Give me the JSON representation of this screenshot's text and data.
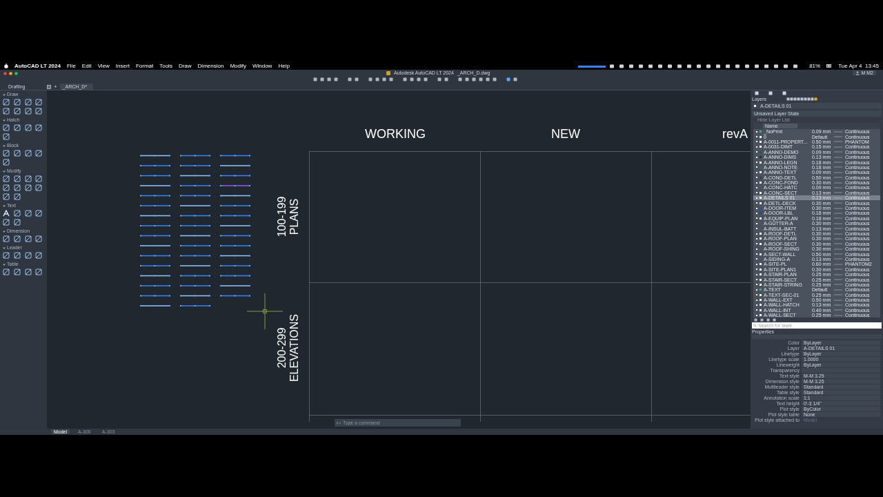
{
  "menu_bar": {
    "app": "AutoCAD LT 2024",
    "items": [
      "File",
      "Edit",
      "View",
      "Insert",
      "Format",
      "Tools",
      "Draw",
      "Dimension",
      "Modify",
      "Window",
      "Help"
    ],
    "battery": "81%",
    "clock": "Tue Apr 4  13:45"
  },
  "window": {
    "title": "Autodesk AutoCAD LT 2024",
    "file": "_ARCH_D.dwg",
    "user": "M M2"
  },
  "tool_palette": {
    "title": "Drafting",
    "sections": [
      "Draw",
      "Hatch",
      "Block",
      "Modify",
      "Text",
      "Dimension",
      "Leader",
      "Table"
    ]
  },
  "tabs": [
    {
      "label": "_ARCH_D*",
      "selected": true
    }
  ],
  "new_tab": "+",
  "canvas": {
    "headings": [
      "WORKING",
      "NEW",
      "revA"
    ],
    "bands": [
      {
        "range": "100-199",
        "label": "PLANS"
      },
      {
        "range": "200-299",
        "label": "ELEVATIONS"
      }
    ]
  },
  "command_line": {
    "placeholder": "Type a command"
  },
  "layout_tabs": [
    {
      "label": "Model",
      "selected": true
    },
    {
      "label": "A-300",
      "selected": false
    },
    {
      "label": "A-303",
      "selected": false
    }
  ],
  "layers_panel": {
    "title": "Layers",
    "current_layer": "A-DETAILS 01",
    "layer_state": "Unsaved Layer State",
    "toggle": "Hide Layer List",
    "name_column": "Name",
    "search": {
      "placeholder": "Search for layer"
    },
    "layers": [
      {
        "name": "_NoPrint",
        "lineweight": "0.09 mm",
        "linetype": "Continuous",
        "color": "#22c55e",
        "selected": false
      },
      {
        "name": "0",
        "lineweight": "Default",
        "linetype": "Continuous",
        "color": "#ffffff",
        "selected": false
      },
      {
        "name": "A-0011-PROPERT...",
        "lineweight": "0.50 mm",
        "linetype": "PHANTOM",
        "color": "#ffffff",
        "selected": false
      },
      {
        "name": "A-0031-DIMT",
        "lineweight": "0.15 mm",
        "linetype": "Continuous",
        "color": "#ffffff",
        "selected": false
      },
      {
        "name": "A-ANNO-DEMO",
        "lineweight": "0.09 mm",
        "linetype": "Continuous",
        "color": "#166534",
        "selected": false
      },
      {
        "name": "A-ANNO-DIMS",
        "lineweight": "0.13 mm",
        "linetype": "Continuous",
        "color": "#1e3a2f",
        "selected": false
      },
      {
        "name": "A-ANNO-LEGN",
        "lineweight": "0.18 mm",
        "linetype": "Continuous",
        "color": "#ffffff",
        "selected": false
      },
      {
        "name": "A-ANNO-NOTE",
        "lineweight": "0.18 mm",
        "linetype": "Continuous",
        "color": "#15803d",
        "selected": false
      },
      {
        "name": "A-ANNO-TEXT",
        "lineweight": "0.09 mm",
        "linetype": "Continuous",
        "color": "#ffffff",
        "selected": false
      },
      {
        "name": "A-COND-DETL",
        "lineweight": "0.50 mm",
        "linetype": "Continuous",
        "color": "#334155",
        "selected": false
      },
      {
        "name": "A-CONC-FOND",
        "lineweight": "0.30 mm",
        "linetype": "Continuous",
        "color": "#ffffff",
        "selected": false
      },
      {
        "name": "A-CONC-HATC",
        "lineweight": "0.09 mm",
        "linetype": "Continuous",
        "color": "#475569",
        "selected": false
      },
      {
        "name": "A-CONC-SECT",
        "lineweight": "0.13 mm",
        "linetype": "Continuous",
        "color": "#ffffff",
        "selected": false
      },
      {
        "name": "A-DETAILS 01",
        "lineweight": "0.13 mm",
        "linetype": "Continuous",
        "color": "#ffffff",
        "selected": true
      },
      {
        "name": "A-DETL-DECK",
        "lineweight": "0.30 mm",
        "linetype": "Continuous",
        "color": "#ffffff",
        "selected": false
      },
      {
        "name": "A-DOOR-ITEM",
        "lineweight": "0.30 mm",
        "linetype": "Continuous",
        "color": "#1d4ed8",
        "selected": false
      },
      {
        "name": "A-DOOR-LBL",
        "lineweight": "0.18 mm",
        "linetype": "Continuous",
        "color": "#1e40af",
        "selected": false
      },
      {
        "name": "A-EQUIP-PLAN",
        "lineweight": "0.18 mm",
        "linetype": "Continuous",
        "color": "#ffffff",
        "selected": false
      },
      {
        "name": "A-GUTTER-A",
        "lineweight": "0.30 mm",
        "linetype": "Continuous",
        "color": "#475569",
        "selected": false
      },
      {
        "name": "A-INSUL-BATT",
        "lineweight": "0.13 mm",
        "linetype": "Continuous",
        "color": "#475569",
        "selected": false
      },
      {
        "name": "A-ROOF-DETL",
        "lineweight": "0.30 mm",
        "linetype": "Continuous",
        "color": "#ffffff",
        "selected": false
      },
      {
        "name": "A-ROOF-PLAN",
        "lineweight": "0.30 mm",
        "linetype": "Continuous",
        "color": "#ffffff",
        "selected": false
      },
      {
        "name": "A-ROOF-SECT",
        "lineweight": "0.30 mm",
        "linetype": "Continuous",
        "color": "#ffffff",
        "selected": false
      },
      {
        "name": "A-ROOF-SHING",
        "lineweight": "0.30 mm",
        "linetype": "Continuous",
        "color": "#475569",
        "selected": false
      },
      {
        "name": "A-SECT-WALL",
        "lineweight": "0.50 mm",
        "linetype": "Continuous",
        "color": "#ffffff",
        "selected": false
      },
      {
        "name": "A-SIDING-A",
        "lineweight": "0.13 mm",
        "linetype": "Continuous",
        "color": "#475569",
        "selected": false
      },
      {
        "name": "A-SITE-PL",
        "lineweight": "0.60 mm",
        "linetype": "PHANTOM2",
        "color": "#ffffff",
        "selected": false
      },
      {
        "name": "A-SITE-PLAN1",
        "lineweight": "0.30 mm",
        "linetype": "Continuous",
        "color": "#ffffff",
        "selected": false
      },
      {
        "name": "A-STAIR-PLAN",
        "lineweight": "0.25 mm",
        "linetype": "Continuous",
        "color": "#ffffff",
        "selected": false
      },
      {
        "name": "A-STAIR-SECT",
        "lineweight": "0.25 mm",
        "linetype": "Continuous",
        "color": "#ffffff",
        "selected": false
      },
      {
        "name": "A-STAIR-STRING",
        "lineweight": "0.25 mm",
        "linetype": "Continuous",
        "color": "#ffffff",
        "selected": false
      },
      {
        "name": "A-TEXT",
        "lineweight": "Default",
        "linetype": "Continuous",
        "color": "#14b8a6",
        "selected": false
      },
      {
        "name": "A-TEXT-SEC-01",
        "lineweight": "0.25 mm",
        "linetype": "Continuous",
        "color": "#ffffff",
        "selected": false
      },
      {
        "name": "A-WALL-EXT",
        "lineweight": "0.50 mm",
        "linetype": "Continuous",
        "color": "#ffffff",
        "selected": false
      },
      {
        "name": "A-WALL-HATCH",
        "lineweight": "0.13 mm",
        "linetype": "Continuous",
        "color": "#ffffff",
        "selected": false
      },
      {
        "name": "A-WALL-INT",
        "lineweight": "0.40 mm",
        "linetype": "Continuous",
        "color": "#ffffff",
        "selected": false
      },
      {
        "name": "A-WALL-SECT",
        "lineweight": "0.25 mm",
        "linetype": "Continuous",
        "color": "#ffffff",
        "selected": false
      }
    ]
  },
  "properties": {
    "title": "Properties",
    "rows": [
      {
        "label": "Color",
        "value": "ByLayer"
      },
      {
        "label": "Layer",
        "value": "A-DETAILS 01"
      },
      {
        "label": "Linetype",
        "value": "ByLayer"
      },
      {
        "label": "Linetype scale",
        "value": "1.0000"
      },
      {
        "label": "Lineweight",
        "value": "ByLayer"
      },
      {
        "label": "Transparency"
      },
      {
        "label": "Text style",
        "value": "M-M 3.25"
      },
      {
        "label": "Dimension style",
        "value": "M-M 3.25"
      },
      {
        "label": "Multileader style",
        "value": "Standard"
      },
      {
        "label": "Table style",
        "value": "Standard"
      },
      {
        "label": "Annotation scale",
        "value": "1:1"
      },
      {
        "label": "Text height",
        "value": "0'-3 1/4\""
      },
      {
        "label": "Plot style",
        "value": "ByColor"
      },
      {
        "label": "Plot style table",
        "value": "None"
      },
      {
        "label": "Plot style attached to",
        "value": "Model",
        "disabled": true
      }
    ]
  }
}
